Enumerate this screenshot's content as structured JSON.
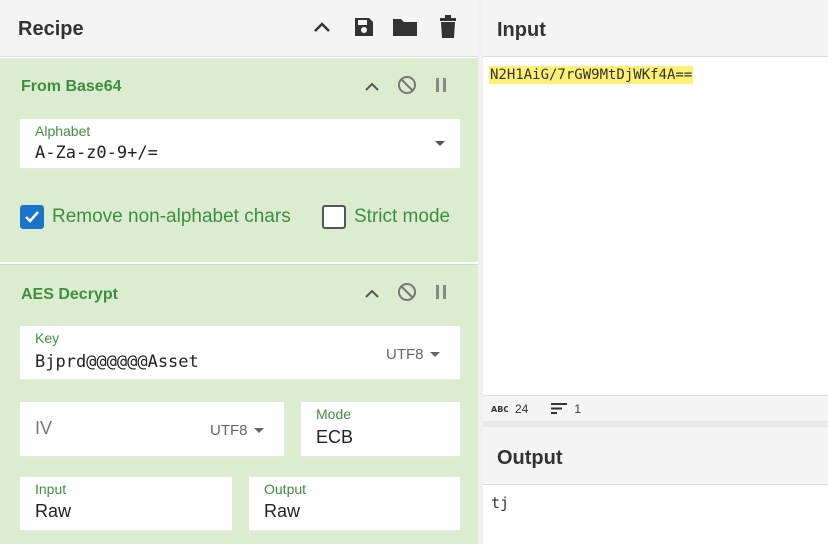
{
  "recipe": {
    "title": "Recipe",
    "header_icons": [
      "chevron-up-icon",
      "save-icon",
      "folder-icon",
      "trash-icon"
    ],
    "operations": [
      {
        "title": "From Base64",
        "alphabet": {
          "label": "Alphabet",
          "value": "A-Za-z0-9+/="
        },
        "remove_non_alphabet": {
          "label": "Remove non-alphabet chars",
          "checked": true
        },
        "strict_mode": {
          "label": "Strict mode",
          "checked": false
        }
      },
      {
        "title": "AES Decrypt",
        "key": {
          "label": "Key",
          "value": "Bjprd@@@@@@Asset",
          "encoding": "UTF8"
        },
        "iv": {
          "placeholder": "IV",
          "encoding": "UTF8"
        },
        "mode": {
          "label": "Mode",
          "value": "ECB"
        },
        "input": {
          "label": "Input",
          "value": "Raw"
        },
        "output": {
          "label": "Output",
          "value": "Raw"
        }
      }
    ]
  },
  "input": {
    "title": "Input",
    "text": "N2H1AiG/7rGW9MtDjWKf4A==",
    "stats": {
      "length": "24",
      "lines": "1"
    }
  },
  "output": {
    "title": "Output",
    "text": "tj"
  },
  "colors": {
    "op_background": "#dbeccf",
    "op_title": "#3e8e41",
    "checkbox_checked": "#1a73c8",
    "input_highlight": "#fff176"
  }
}
